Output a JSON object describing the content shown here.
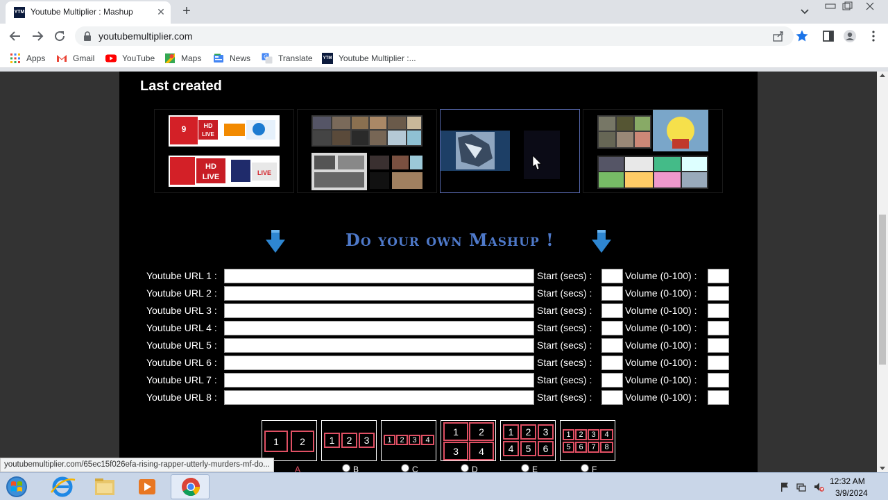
{
  "browser": {
    "tab_title": "Youtube Multiplier : Mashup",
    "tab_favicon_text": "YTM",
    "url": "youtubemultiplier.com",
    "bookmarks": [
      "Apps",
      "Gmail",
      "YouTube",
      "Maps",
      "News",
      "Translate",
      "Youtube Multiplier :..."
    ]
  },
  "page": {
    "last_created_title": "Last created",
    "mashup_title": "Do your own Mashup !",
    "url_rows": [
      {
        "label": "Youtube URL 1 :",
        "start_label": "Start (secs) :",
        "volume_label": "Volume (0-100) :"
      },
      {
        "label": "Youtube URL 2 :",
        "start_label": "Start (secs) :",
        "volume_label": "Volume (0-100) :"
      },
      {
        "label": "Youtube URL 3 :",
        "start_label": "Start (secs) :",
        "volume_label": "Volume (0-100) :"
      },
      {
        "label": "Youtube URL 4 :",
        "start_label": "Start (secs) :",
        "volume_label": "Volume (0-100) :"
      },
      {
        "label": "Youtube URL 5 :",
        "start_label": "Start (secs) :",
        "volume_label": "Volume (0-100) :"
      },
      {
        "label": "Youtube URL 6 :",
        "start_label": "Start (secs) :",
        "volume_label": "Volume (0-100) :"
      },
      {
        "label": "Youtube URL 7 :",
        "start_label": "Start (secs) :",
        "volume_label": "Volume (0-100) :"
      },
      {
        "label": "Youtube URL 8 :",
        "start_label": "Start (secs) :",
        "volume_label": "Volume (0-100) :"
      }
    ],
    "layouts": [
      {
        "label": "A",
        "cells": [
          "1",
          "2"
        ]
      },
      {
        "label": "B",
        "cells": [
          "1",
          "2",
          "3"
        ]
      },
      {
        "label": "C",
        "cells": [
          "1",
          "2",
          "3",
          "4"
        ]
      },
      {
        "label": "D",
        "cells": [
          "1",
          "2",
          "3",
          "4"
        ]
      },
      {
        "label": "E",
        "cells": [
          "1",
          "2",
          "3",
          "4",
          "5",
          "6"
        ]
      },
      {
        "label": "F",
        "cells": [
          "1",
          "2",
          "3",
          "4",
          "5",
          "6",
          "7",
          "8"
        ]
      }
    ],
    "thumbnails": [
      {
        "name": "news-channels-mashup",
        "texts": [
          "9",
          "HD",
          "LIVE",
          "HD",
          "LIVE",
          "LIVE"
        ]
      },
      {
        "name": "video-grid-mashup",
        "texts": []
      },
      {
        "name": "comic-mashup",
        "texts": []
      },
      {
        "name": "cartoon-mashup",
        "texts": []
      }
    ]
  },
  "status_bar": {
    "link_url": "youtubemultiplier.com/65ec15f026efa-rising-rapper-utterly-murders-mf-do..."
  },
  "taskbar": {
    "time": "12:32 AM",
    "date": "3/9/2024"
  },
  "colors": {
    "page_background": "#000000",
    "side_background": "#333333",
    "mashup_title": "#4e79c9",
    "layout_cell_border": "#e05064",
    "arrow": "#2e86d1"
  }
}
